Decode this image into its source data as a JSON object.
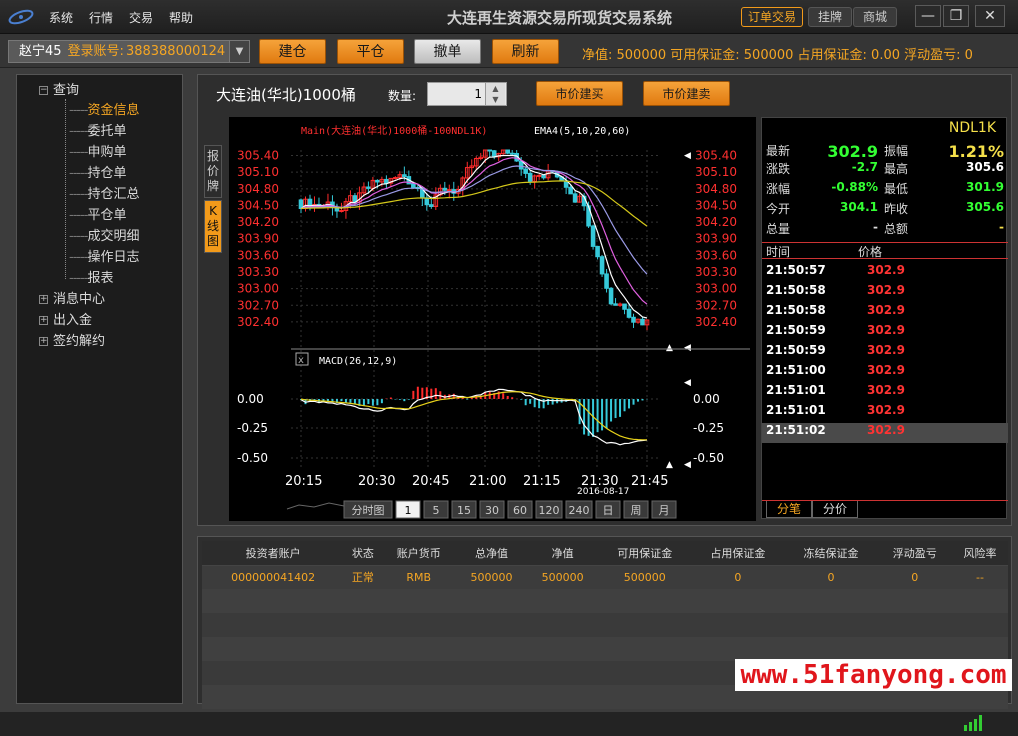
{
  "titlebar": {
    "menu": [
      "系统",
      "行情",
      "交易",
      "帮助"
    ],
    "title": "大连再生资源交易所现货交易系统",
    "tabs": [
      "订单交易",
      "挂牌",
      "商城"
    ]
  },
  "toolbar": {
    "account_name": "赵宁45",
    "account_label": "登录账号:",
    "account_value": "388388000124",
    "buttons": [
      "建仓",
      "平仓",
      "撤单",
      "刷新"
    ],
    "info": "净值: 500000  可用保证金: 500000  占用保证金: 0.00  浮动盈亏: 0"
  },
  "tree": {
    "query": "查询",
    "children": [
      "资金信息",
      "委托单",
      "申购单",
      "持仓单",
      "持仓汇总",
      "平仓单",
      "成交明细",
      "操作日志",
      "报表"
    ],
    "others": [
      "消息中心",
      "出入金",
      "签约解约"
    ]
  },
  "product": {
    "title": "大连油(华北)1000桶",
    "qty_label": "数量:",
    "qty": "1",
    "buy_label": "市价建买",
    "sell_label": "市价建卖"
  },
  "side_tabs": [
    "报价牌",
    "K线图"
  ],
  "chart_data": {
    "type": "candlestick",
    "title": "Main(大连油(华北)1000桶-100NDL1K)",
    "indicator": "EMA4(5,10,20,60)",
    "yticks": [
      "305.40",
      "305.10",
      "304.80",
      "304.50",
      "304.20",
      "303.90",
      "303.60",
      "303.30",
      "303.00",
      "302.70",
      "302.40"
    ],
    "ylim": [
      302.2,
      305.5
    ],
    "macd_label": "MACD(26,12,9)",
    "macd_yticks": [
      "0.00",
      "-0.25",
      "-0.50"
    ],
    "xticks": [
      "20:15",
      "20:30",
      "20:45",
      "21:00",
      "21:15",
      "21:30",
      "21:45"
    ],
    "date": "2016-08-17",
    "periods": [
      "分时图",
      "1",
      "5",
      "15",
      "30",
      "60",
      "120",
      "240",
      "日",
      "周",
      "月"
    ],
    "selected_period": "1"
  },
  "quote": {
    "code": "NDL1K",
    "rows": [
      [
        "最新",
        "302.9",
        "振幅",
        "1.21%"
      ],
      [
        "涨跌",
        "-2.7",
        "最高",
        "305.6"
      ],
      [
        "涨幅",
        "-0.88%",
        "最低",
        "301.9"
      ],
      [
        "今开",
        "304.1",
        "昨收",
        "305.6"
      ],
      [
        "总量",
        "-",
        "总额",
        "-"
      ]
    ],
    "header": [
      "时间",
      "价格"
    ],
    "ticks": [
      [
        "21:50:57",
        "302.9"
      ],
      [
        "21:50:58",
        "302.9"
      ],
      [
        "21:50:58",
        "302.9"
      ],
      [
        "21:50:59",
        "302.9"
      ],
      [
        "21:50:59",
        "302.9"
      ],
      [
        "21:51:00",
        "302.9"
      ],
      [
        "21:51:01",
        "302.9"
      ],
      [
        "21:51:01",
        "302.9"
      ],
      [
        "21:51:02",
        "302.9"
      ]
    ],
    "tabs": [
      "分笔",
      "分价"
    ]
  },
  "table": {
    "headers": [
      "投资者账户",
      "状态",
      "账户货币",
      "总净值",
      "净值",
      "可用保证金",
      "占用保证金",
      "冻结保证金",
      "浮动盈亏",
      "风险率"
    ],
    "rows": [
      [
        "000000041402",
        "正常",
        "RMB",
        "500000",
        "500000",
        "500000",
        "0",
        "0",
        "0",
        "--"
      ]
    ]
  },
  "watermark": "www.51fanyong.com"
}
